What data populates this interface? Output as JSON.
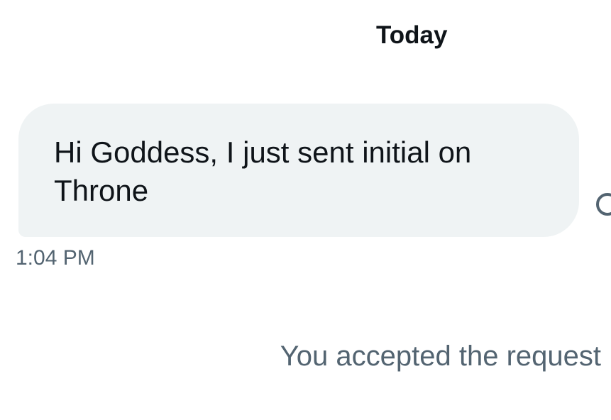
{
  "conversation": {
    "date_header": "Today",
    "messages": [
      {
        "text": "Hi Goddess, I just sent initial on\nThrone",
        "time": "1:04 PM"
      }
    ],
    "system_note": "You accepted the request"
  },
  "icons": {
    "reaction": "add-reaction-icon"
  },
  "colors": {
    "bubble_background": "#eff3f4",
    "primary_text": "#0f1419",
    "secondary_text": "#536471"
  }
}
